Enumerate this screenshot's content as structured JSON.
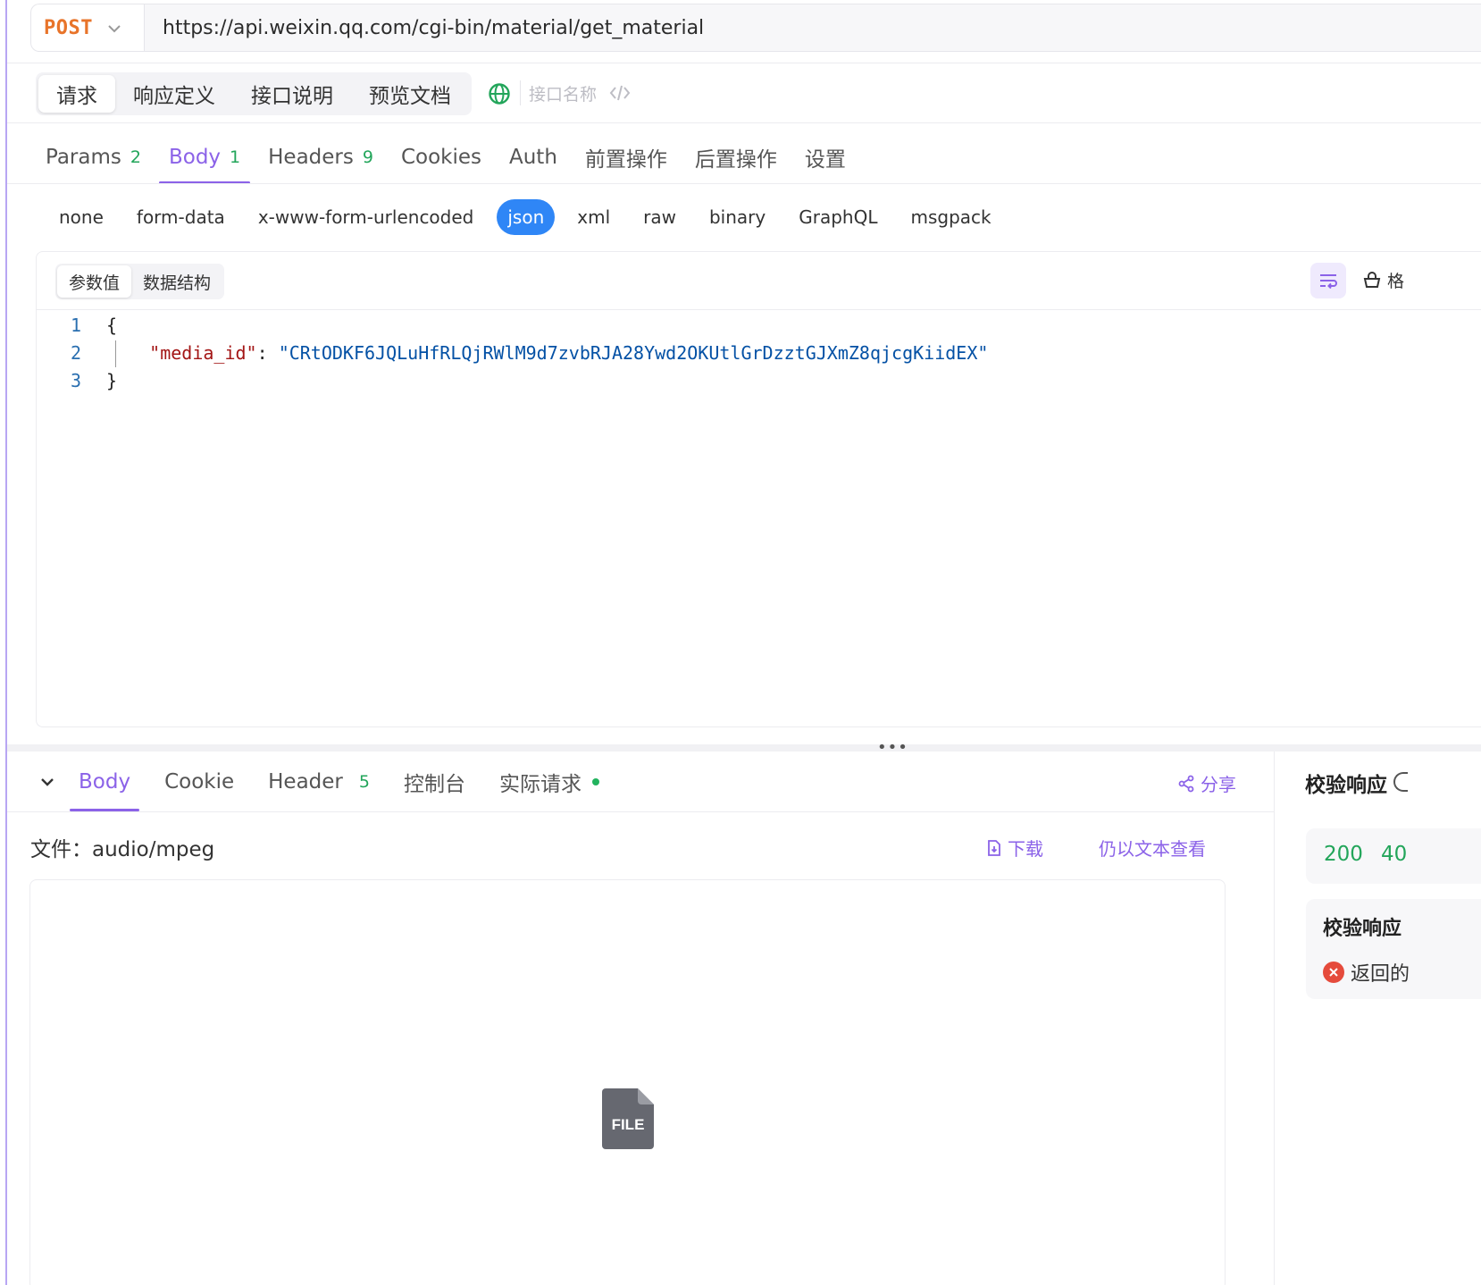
{
  "request": {
    "method": "POST",
    "url": "https://api.weixin.qq.com/cgi-bin/material/get_material"
  },
  "top_tabs": [
    {
      "label": "请求",
      "active": true
    },
    {
      "label": "响应定义",
      "active": false
    },
    {
      "label": "接口说明",
      "active": false
    },
    {
      "label": "预览文档",
      "active": false
    }
  ],
  "name_placeholder": "接口名称",
  "req_tabs": [
    {
      "label": "Params",
      "count": "2",
      "active": false
    },
    {
      "label": "Body",
      "count": "1",
      "active": true
    },
    {
      "label": "Headers",
      "count": "9",
      "active": false
    },
    {
      "label": "Cookies",
      "count": "",
      "active": false
    },
    {
      "label": "Auth",
      "count": "",
      "active": false
    },
    {
      "label": "前置操作",
      "count": "",
      "active": false
    },
    {
      "label": "后置操作",
      "count": "",
      "active": false
    },
    {
      "label": "设置",
      "count": "",
      "active": false
    }
  ],
  "body_types": [
    "none",
    "form-data",
    "x-www-form-urlencoded",
    "json",
    "xml",
    "raw",
    "binary",
    "GraphQL",
    "msgpack"
  ],
  "body_type_active": "json",
  "editor": {
    "mode_tabs": [
      "参数值",
      "数据结构"
    ],
    "format_label": "格",
    "lines": [
      {
        "num": "1",
        "text": "{"
      },
      {
        "num": "2",
        "key": "\"media_id\"",
        "sep": ": ",
        "value": "\"CRtODKF6JQLuHfRLQjRWlM9d7zvbRJA28Ywd2OKUtlGrDzztGJXmZ8qjcgKiidEX\""
      },
      {
        "num": "3",
        "text": "}"
      }
    ]
  },
  "response": {
    "tabs": [
      {
        "label": "Body",
        "count": "",
        "active": true
      },
      {
        "label": "Cookie",
        "count": "",
        "active": false
      },
      {
        "label": "Header",
        "count": "5",
        "active": false
      },
      {
        "label": "控制台",
        "count": "",
        "active": false
      },
      {
        "label": "实际请求",
        "count": "",
        "active": false,
        "dot": true
      }
    ],
    "share_label": "分享",
    "file_label": "文件：audio/mpeg",
    "download_label": "下载",
    "view_as_text_label": "仍以文本查看",
    "file_icon_text": "FILE"
  },
  "validation": {
    "title": "校验响应",
    "codes": [
      "200",
      "40"
    ],
    "card_title": "校验响应",
    "error_text": "返回的"
  },
  "colors": {
    "accent": "#8b62e8",
    "method": "#e8742a",
    "json_active": "#2f86f6",
    "count_green": "#22a55a",
    "error": "#e54b3c"
  }
}
